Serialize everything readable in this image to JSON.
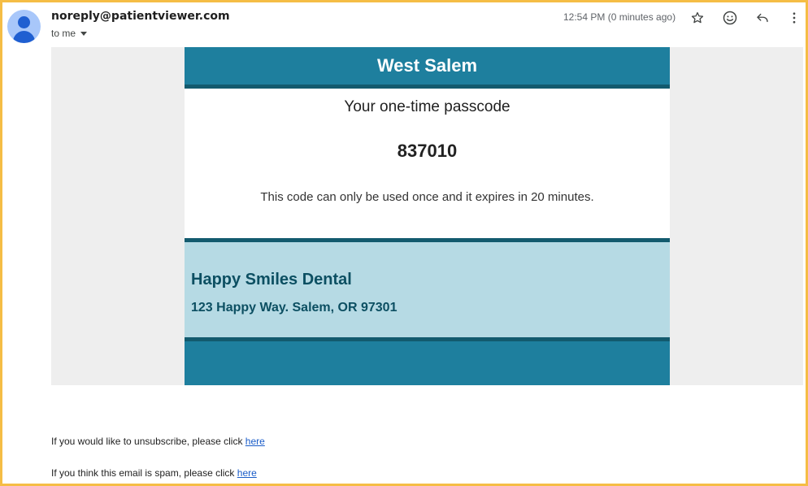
{
  "header": {
    "sender": "noreply@patientviewer.com",
    "recipient": "to me",
    "timestamp": "12:54 PM (0 minutes ago)",
    "icons": [
      "star-icon",
      "emoji-icon",
      "reply-icon",
      "more-vert-icon"
    ]
  },
  "email": {
    "brand": "West Salem",
    "otp_title": "Your one-time passcode",
    "otp_code": "837010",
    "otp_note": "This code can only be used once and it expires in 20 minutes.",
    "office_name": "Happy Smiles Dental",
    "office_address": "123 Happy Way. Salem, OR 97301"
  },
  "footer": {
    "unsubscribe_text": "If you would like to unsubscribe, please click ",
    "unsubscribe_link": "here",
    "spam_text": "If you think this email is spam, please click ",
    "spam_link": "here"
  },
  "colors": {
    "frame": "#f5bd45",
    "brand_teal": "#1e7f9e",
    "brand_dark": "#135a6e",
    "office_bg": "#b6dae4",
    "office_text": "#0c4f62",
    "link": "#1a5cc8"
  }
}
